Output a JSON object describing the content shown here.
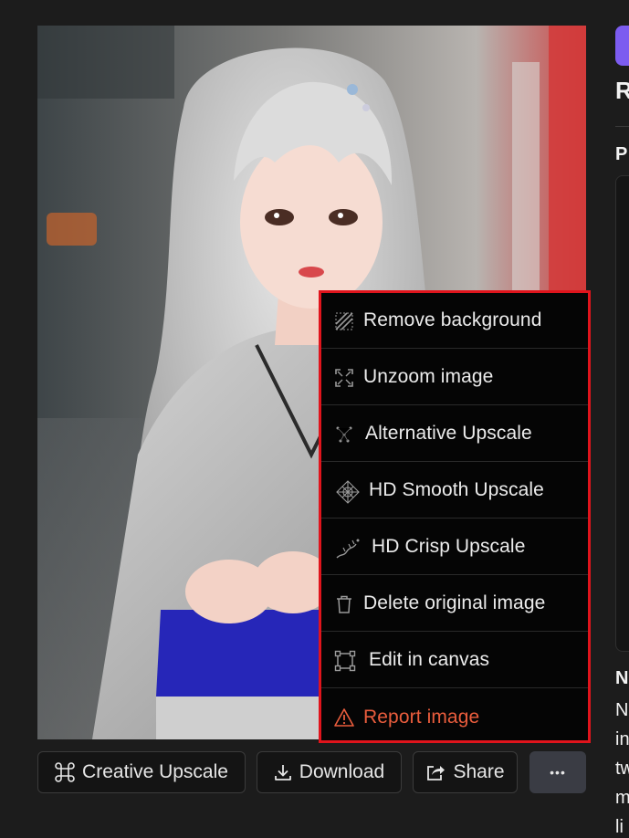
{
  "menu": {
    "items": [
      {
        "label": "Remove background",
        "icon": "remove-background-icon"
      },
      {
        "label": "Unzoom image",
        "icon": "unzoom-icon"
      },
      {
        "label": "Alternative Upscale",
        "icon": "alternative-upscale-icon"
      },
      {
        "label": "HD Smooth Upscale",
        "icon": "hd-smooth-upscale-icon"
      },
      {
        "label": "HD Crisp Upscale",
        "icon": "hd-crisp-upscale-icon"
      },
      {
        "label": "Delete original image",
        "icon": "trash-icon"
      },
      {
        "label": "Edit in canvas",
        "icon": "canvas-icon"
      },
      {
        "label": "Report image",
        "icon": "warning-icon"
      }
    ],
    "highlight_color": "#e0141c",
    "danger_color": "#ea5d3d"
  },
  "actions": {
    "creative_upscale": "Creative Upscale",
    "download": "Download",
    "share": "Share",
    "more": "•••"
  },
  "right_panel": {
    "title_initial": "R",
    "section_initial": "P",
    "lower_heading_initial": "N",
    "lower_lines": [
      "N",
      "in",
      "tw",
      "m",
      "li"
    ],
    "accent": "#7c5cf0"
  }
}
